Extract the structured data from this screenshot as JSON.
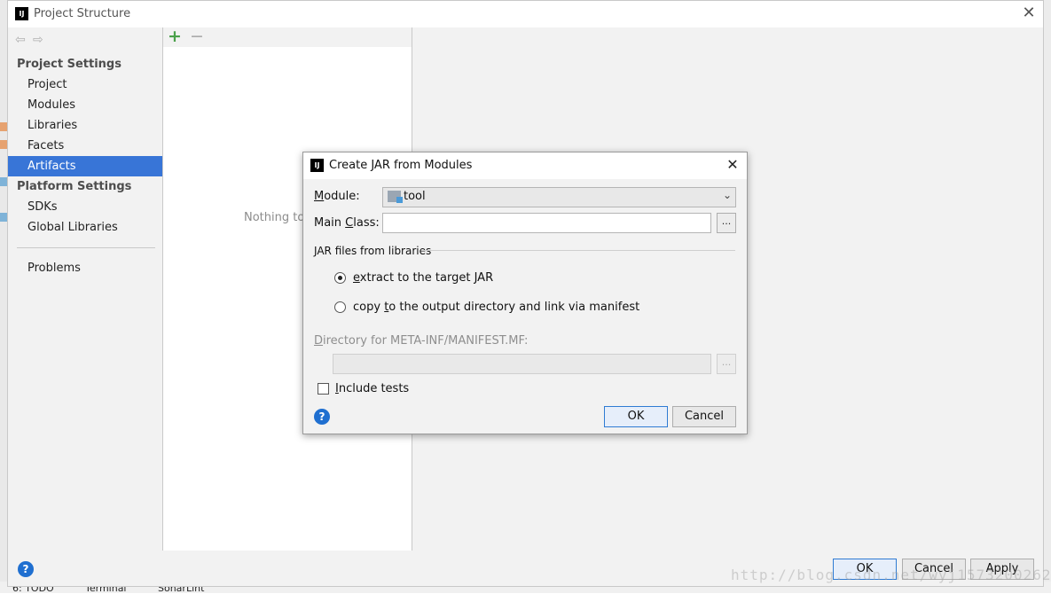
{
  "window": {
    "title": "Project Structure",
    "app_icon": "IJ"
  },
  "sidebar": {
    "project_settings_header": "Project Settings",
    "project_items": [
      {
        "label": "Project"
      },
      {
        "label": "Modules"
      },
      {
        "label": "Libraries"
      },
      {
        "label": "Facets"
      },
      {
        "label": "Artifacts",
        "selected": true
      }
    ],
    "platform_settings_header": "Platform Settings",
    "platform_items": [
      {
        "label": "SDKs"
      },
      {
        "label": "Global Libraries"
      }
    ],
    "problems_label": "Problems"
  },
  "middle_panel": {
    "empty_text": "Nothing to"
  },
  "footer": {
    "ok_label": "OK",
    "cancel_label": "Cancel",
    "apply_label": "Apply",
    "watermark": "http://blog.csdn.net/wyj15732002629"
  },
  "ide_bottom_bar": {
    "todo": "6: TODO",
    "terminal": "Terminal",
    "sonarlint": "SonarLint"
  },
  "dialog": {
    "title": "Create JAR from Modules",
    "module_label_prefix": "M",
    "module_label_rest": "odule:",
    "module_value": "tool",
    "main_class_label_pre": "Main ",
    "main_class_label_u": "C",
    "main_class_label_post": "lass:",
    "main_class_value": "",
    "jar_group_label": "JAR files from libraries",
    "extract_option_u": "e",
    "extract_option_rest": "xtract to the target JAR",
    "copy_option_pre": "copy ",
    "copy_option_u": "t",
    "copy_option_post": "o the output directory and link via manifest",
    "selected_option": "extract",
    "manifest_dir_label_u": "D",
    "manifest_dir_label_rest": "irectory for META-INF/MANIFEST.MF:",
    "manifest_dir_value": "",
    "include_tests_u": "I",
    "include_tests_rest": "nclude tests",
    "include_tests_checked": false,
    "ok_label": "OK",
    "cancel_label": "Cancel",
    "browse_label": "..."
  },
  "colors": {
    "selection": "#3875d7",
    "help_icon": "#1f6fd0",
    "add_icon": "#4aa04a"
  }
}
